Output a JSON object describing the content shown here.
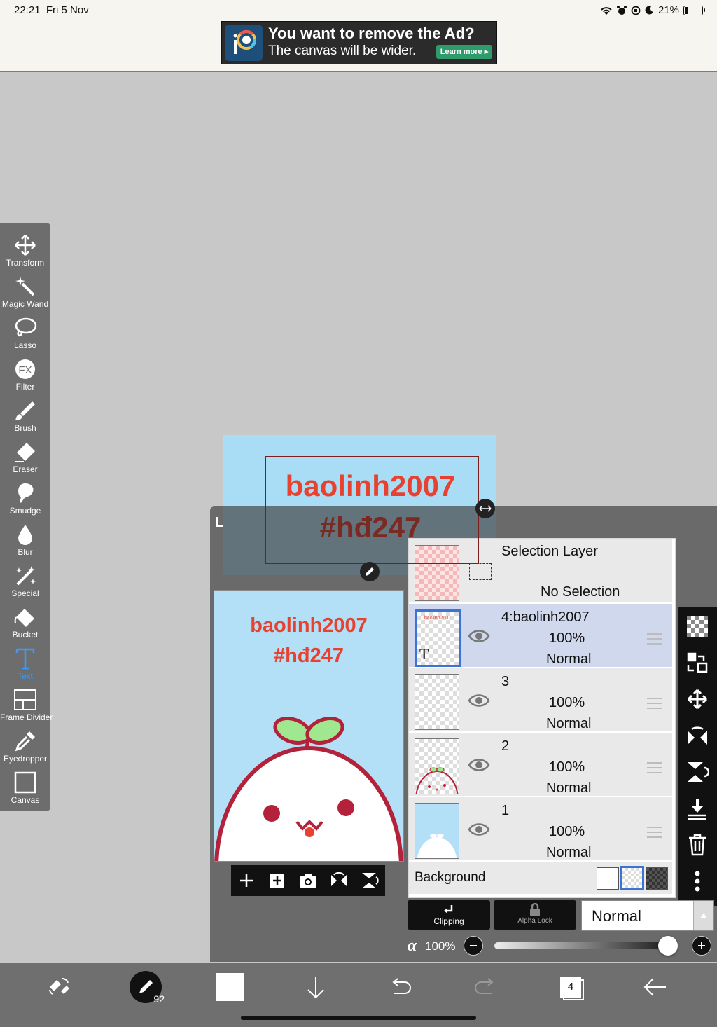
{
  "status_bar": {
    "time": "22:21",
    "date": "Fri 5 Nov",
    "battery": "21%"
  },
  "ad": {
    "title": "You want to remove the Ad?",
    "subtitle": "The canvas will be wider.",
    "learn_more": "Learn more"
  },
  "tools": [
    {
      "label": "Transform",
      "icon": "move-arrows-icon"
    },
    {
      "label": "Magic Wand",
      "icon": "magic-wand-icon"
    },
    {
      "label": "Lasso",
      "icon": "lasso-icon"
    },
    {
      "label": "Filter",
      "icon": "fx-icon"
    },
    {
      "label": "Brush",
      "icon": "brush-icon"
    },
    {
      "label": "Eraser",
      "icon": "eraser-icon"
    },
    {
      "label": "Smudge",
      "icon": "smudge-icon"
    },
    {
      "label": "Blur",
      "icon": "drop-icon"
    },
    {
      "label": "Special",
      "icon": "sparkle-icon"
    },
    {
      "label": "Bucket",
      "icon": "bucket-icon"
    },
    {
      "label": "Text",
      "icon": "text-icon"
    },
    {
      "label": "Frame Divider",
      "icon": "frame-icon"
    },
    {
      "label": "Eyedropper",
      "icon": "eyedropper-icon"
    },
    {
      "label": "Canvas",
      "icon": "canvas-icon"
    }
  ],
  "canvas": {
    "line1": "baolinh2007",
    "line2": "#hđ247"
  },
  "layer_panel": {
    "title": "Layer",
    "preview": {
      "line1": "baolinh2007",
      "line2": "#hđ247"
    },
    "selection_layer": {
      "name": "Selection Layer",
      "status": "No Selection"
    },
    "layers": [
      {
        "name": "4:baolinh2007",
        "opacity": "100%",
        "blend": "Normal",
        "selected": true,
        "thumb_text": "baolinh2007"
      },
      {
        "name": "3",
        "opacity": "100%",
        "blend": "Normal",
        "selected": false
      },
      {
        "name": "2",
        "opacity": "100%",
        "blend": "Normal",
        "selected": false
      },
      {
        "name": "1",
        "opacity": "100%",
        "blend": "Normal",
        "selected": false
      }
    ],
    "background_label": "Background",
    "clipping_label": "Clipping",
    "alpha_lock_label": "Alpha Lock",
    "blend_mode": "Normal",
    "alpha_symbol": "α",
    "opacity_value": "100%",
    "opacity_fraction": 1.0
  },
  "bottom_bar": {
    "brush_size": "92",
    "layer_count": "4"
  },
  "colors": {
    "accent_blue": "#3a9bff",
    "canvas_text": "#e8412f",
    "panel": "#6a6a6a"
  }
}
